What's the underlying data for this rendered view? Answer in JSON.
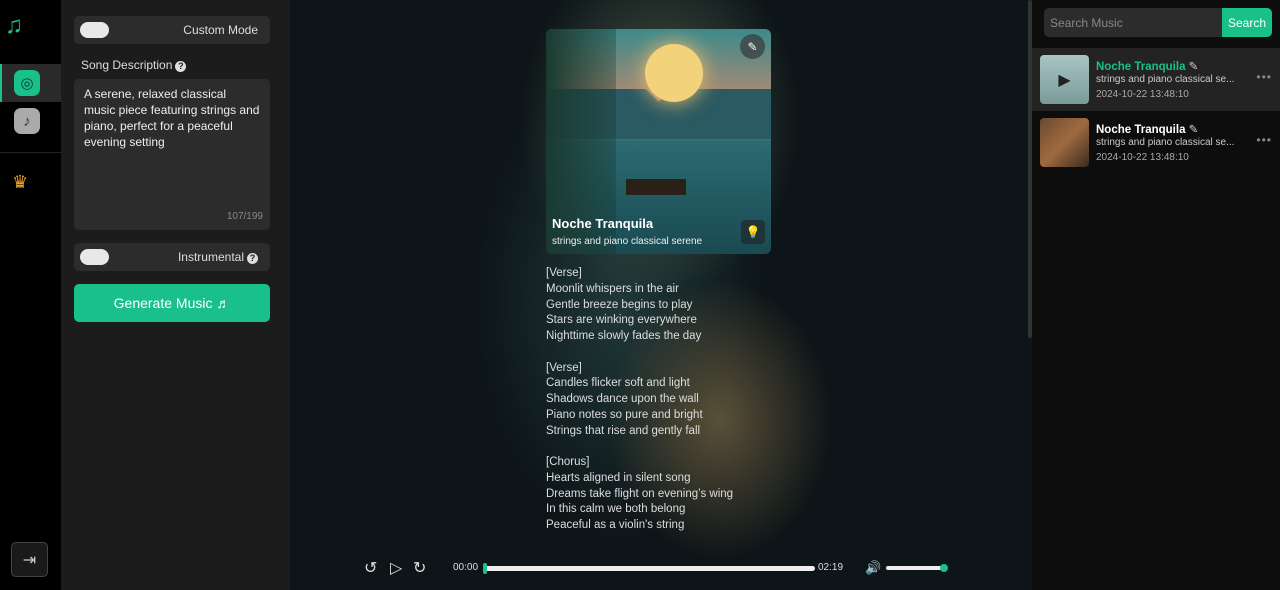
{
  "app": {
    "accent": "#19c08a"
  },
  "rail": {
    "logo_icon": "music-notes-icon",
    "items": [
      {
        "icon": "disc-note-icon",
        "active": true
      },
      {
        "icon": "sound-disc-icon",
        "active": false
      }
    ],
    "premium_icon": "crown-icon",
    "exit_icon": "sign-in-icon"
  },
  "panel": {
    "custom_mode": "Custom Mode",
    "custom_mode_on": false,
    "desc_label": "Song Description",
    "description": "A serene, relaxed classical music piece featuring strings and piano, perfect for a peaceful evening setting",
    "char_count": "107/199",
    "instrumental": "Instrumental",
    "instrumental_on": false,
    "generate": "Generate Music ♬"
  },
  "song": {
    "title": "Noche Tranquila",
    "tags": "strings and piano classical serene",
    "lyrics": "[Verse]\nMoonlit whispers in the air\nGentle breeze begins to play\nStars are winking everywhere\nNighttime slowly fades the day\n\n[Verse]\nCandles flicker soft and light\nShadows dance upon the wall\nPiano notes so pure and bright\nStrings that rise and gently fall\n\n[Chorus]\nHearts aligned in silent song\nDreams take flight on evening’s wing\nIn this calm we both belong\nPeaceful as a violin's string"
  },
  "player": {
    "current": "00:00",
    "duration": "02:19",
    "progress": 0.0,
    "volume": 1.0
  },
  "library": {
    "search_placeholder": "Search Music",
    "search_button": "Search",
    "items": [
      {
        "title": "Noche Tranquila",
        "subtitle": "strings and piano classical se...",
        "date": "2024-10-22 13:48:10",
        "active": true
      },
      {
        "title": "Noche Tranquila",
        "subtitle": "strings and piano classical se...",
        "date": "2024-10-22 13:48:10",
        "active": false
      }
    ]
  }
}
